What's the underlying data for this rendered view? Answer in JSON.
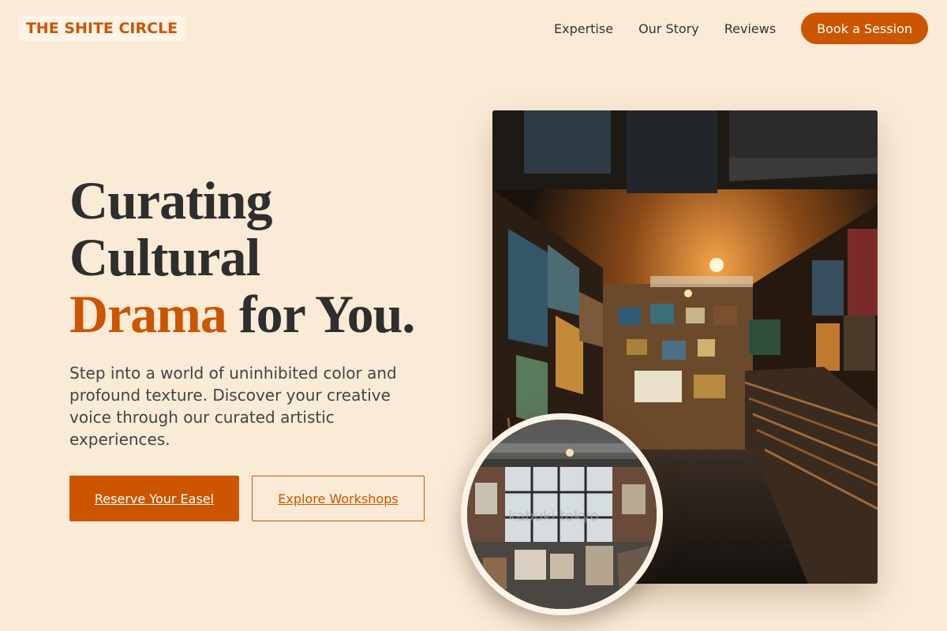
{
  "brand": {
    "name": "THE SHITE CIRCLE"
  },
  "nav": {
    "links": [
      "Expertise",
      "Our Story",
      "Reviews"
    ],
    "cta": "Book a Session"
  },
  "hero": {
    "headline_line1": "Curating",
    "headline_line2": "Cultural",
    "headline_accent": "Drama",
    "headline_rest": " for You.",
    "lede": "Step into a world of uninhibited color and profound texture. Discover your creative voice through our curated artistic experiences.",
    "primary_button": "Reserve Your Easel",
    "secondary_button": "Explore Workshops"
  },
  "images": {
    "main_alt": "Art gallery corridor filled with stacked paintings",
    "inset_watermark": "kabuki tokyo"
  },
  "colors": {
    "accent": "#cc5500",
    "background": "#faebd7",
    "text": "#2e2e2e"
  }
}
